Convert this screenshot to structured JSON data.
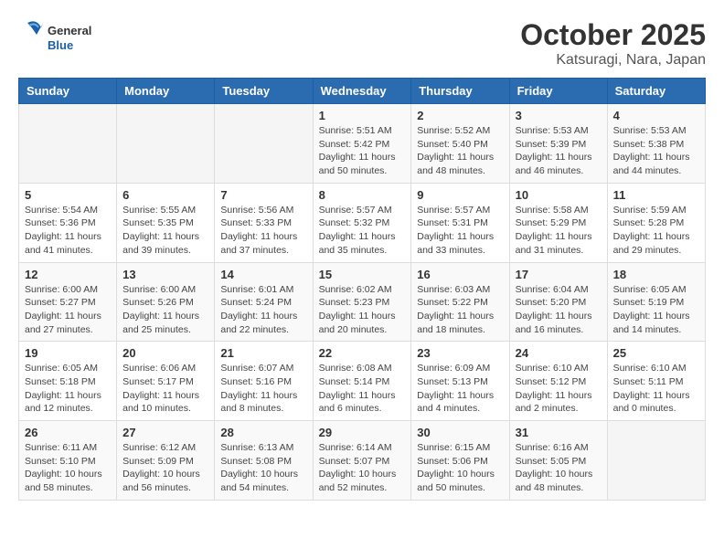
{
  "header": {
    "logo_general": "General",
    "logo_blue": "Blue",
    "month": "October 2025",
    "location": "Katsuragi, Nara, Japan"
  },
  "weekdays": [
    "Sunday",
    "Monday",
    "Tuesday",
    "Wednesday",
    "Thursday",
    "Friday",
    "Saturday"
  ],
  "weeks": [
    [
      {
        "day": "",
        "info": ""
      },
      {
        "day": "",
        "info": ""
      },
      {
        "day": "",
        "info": ""
      },
      {
        "day": "1",
        "info": "Sunrise: 5:51 AM\nSunset: 5:42 PM\nDaylight: 11 hours\nand 50 minutes."
      },
      {
        "day": "2",
        "info": "Sunrise: 5:52 AM\nSunset: 5:40 PM\nDaylight: 11 hours\nand 48 minutes."
      },
      {
        "day": "3",
        "info": "Sunrise: 5:53 AM\nSunset: 5:39 PM\nDaylight: 11 hours\nand 46 minutes."
      },
      {
        "day": "4",
        "info": "Sunrise: 5:53 AM\nSunset: 5:38 PM\nDaylight: 11 hours\nand 44 minutes."
      }
    ],
    [
      {
        "day": "5",
        "info": "Sunrise: 5:54 AM\nSunset: 5:36 PM\nDaylight: 11 hours\nand 41 minutes."
      },
      {
        "day": "6",
        "info": "Sunrise: 5:55 AM\nSunset: 5:35 PM\nDaylight: 11 hours\nand 39 minutes."
      },
      {
        "day": "7",
        "info": "Sunrise: 5:56 AM\nSunset: 5:33 PM\nDaylight: 11 hours\nand 37 minutes."
      },
      {
        "day": "8",
        "info": "Sunrise: 5:57 AM\nSunset: 5:32 PM\nDaylight: 11 hours\nand 35 minutes."
      },
      {
        "day": "9",
        "info": "Sunrise: 5:57 AM\nSunset: 5:31 PM\nDaylight: 11 hours\nand 33 minutes."
      },
      {
        "day": "10",
        "info": "Sunrise: 5:58 AM\nSunset: 5:29 PM\nDaylight: 11 hours\nand 31 minutes."
      },
      {
        "day": "11",
        "info": "Sunrise: 5:59 AM\nSunset: 5:28 PM\nDaylight: 11 hours\nand 29 minutes."
      }
    ],
    [
      {
        "day": "12",
        "info": "Sunrise: 6:00 AM\nSunset: 5:27 PM\nDaylight: 11 hours\nand 27 minutes."
      },
      {
        "day": "13",
        "info": "Sunrise: 6:00 AM\nSunset: 5:26 PM\nDaylight: 11 hours\nand 25 minutes."
      },
      {
        "day": "14",
        "info": "Sunrise: 6:01 AM\nSunset: 5:24 PM\nDaylight: 11 hours\nand 22 minutes."
      },
      {
        "day": "15",
        "info": "Sunrise: 6:02 AM\nSunset: 5:23 PM\nDaylight: 11 hours\nand 20 minutes."
      },
      {
        "day": "16",
        "info": "Sunrise: 6:03 AM\nSunset: 5:22 PM\nDaylight: 11 hours\nand 18 minutes."
      },
      {
        "day": "17",
        "info": "Sunrise: 6:04 AM\nSunset: 5:20 PM\nDaylight: 11 hours\nand 16 minutes."
      },
      {
        "day": "18",
        "info": "Sunrise: 6:05 AM\nSunset: 5:19 PM\nDaylight: 11 hours\nand 14 minutes."
      }
    ],
    [
      {
        "day": "19",
        "info": "Sunrise: 6:05 AM\nSunset: 5:18 PM\nDaylight: 11 hours\nand 12 minutes."
      },
      {
        "day": "20",
        "info": "Sunrise: 6:06 AM\nSunset: 5:17 PM\nDaylight: 11 hours\nand 10 minutes."
      },
      {
        "day": "21",
        "info": "Sunrise: 6:07 AM\nSunset: 5:16 PM\nDaylight: 11 hours\nand 8 minutes."
      },
      {
        "day": "22",
        "info": "Sunrise: 6:08 AM\nSunset: 5:14 PM\nDaylight: 11 hours\nand 6 minutes."
      },
      {
        "day": "23",
        "info": "Sunrise: 6:09 AM\nSunset: 5:13 PM\nDaylight: 11 hours\nand 4 minutes."
      },
      {
        "day": "24",
        "info": "Sunrise: 6:10 AM\nSunset: 5:12 PM\nDaylight: 11 hours\nand 2 minutes."
      },
      {
        "day": "25",
        "info": "Sunrise: 6:10 AM\nSunset: 5:11 PM\nDaylight: 11 hours\nand 0 minutes."
      }
    ],
    [
      {
        "day": "26",
        "info": "Sunrise: 6:11 AM\nSunset: 5:10 PM\nDaylight: 10 hours\nand 58 minutes."
      },
      {
        "day": "27",
        "info": "Sunrise: 6:12 AM\nSunset: 5:09 PM\nDaylight: 10 hours\nand 56 minutes."
      },
      {
        "day": "28",
        "info": "Sunrise: 6:13 AM\nSunset: 5:08 PM\nDaylight: 10 hours\nand 54 minutes."
      },
      {
        "day": "29",
        "info": "Sunrise: 6:14 AM\nSunset: 5:07 PM\nDaylight: 10 hours\nand 52 minutes."
      },
      {
        "day": "30",
        "info": "Sunrise: 6:15 AM\nSunset: 5:06 PM\nDaylight: 10 hours\nand 50 minutes."
      },
      {
        "day": "31",
        "info": "Sunrise: 6:16 AM\nSunset: 5:05 PM\nDaylight: 10 hours\nand 48 minutes."
      },
      {
        "day": "",
        "info": ""
      }
    ]
  ]
}
